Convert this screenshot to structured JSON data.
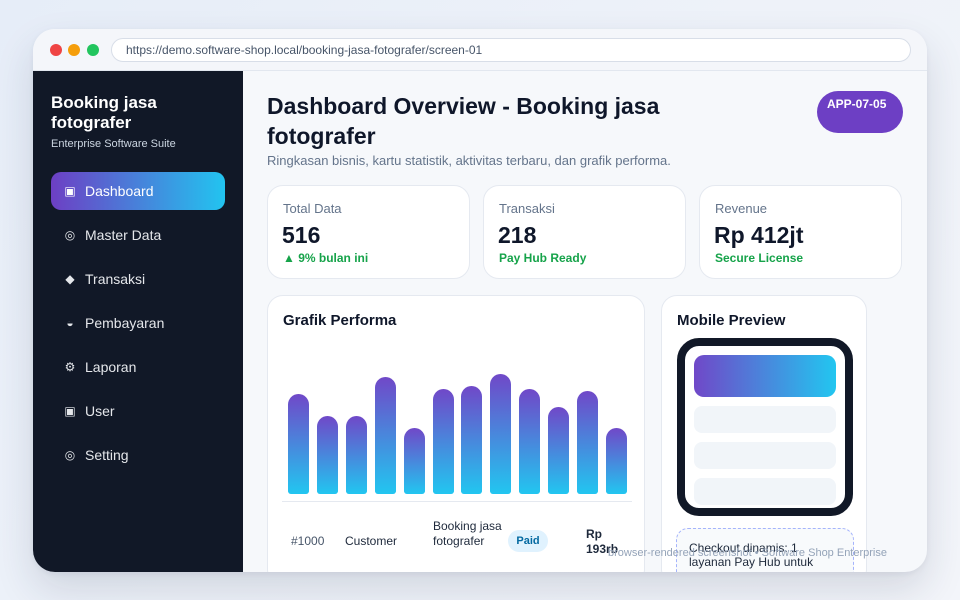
{
  "browser": {
    "url": "https://demo.software-shop.local/booking-jasa-fotografer/screen-01"
  },
  "sidebar": {
    "brand": "Booking jasa fotografer",
    "subtitle": "Enterprise Software Suite",
    "items": [
      {
        "label": "Dashboard",
        "icon": "▣",
        "icon_name": "dashboard-icon",
        "active": true
      },
      {
        "label": "Master Data",
        "icon": "◎",
        "icon_name": "master-data-icon",
        "active": false
      },
      {
        "label": "Transaksi",
        "icon": "◆",
        "icon_name": "transaksi-icon",
        "active": false
      },
      {
        "label": "Pembayaran",
        "icon": "◒",
        "icon_name": "pembayaran-icon",
        "active": false
      },
      {
        "label": "Laporan",
        "icon": "⚙",
        "icon_name": "laporan-icon",
        "active": false
      },
      {
        "label": "User",
        "icon": "▣",
        "icon_name": "user-icon",
        "active": false
      },
      {
        "label": "Setting",
        "icon": "◎",
        "icon_name": "setting-icon",
        "active": false
      }
    ]
  },
  "header": {
    "title": "Dashboard Overview - Booking jasa fotografer",
    "subtitle": "Ringkasan bisnis, kartu statistik, aktivitas terbaru, dan grafik performa.",
    "badge": "APP-07-05"
  },
  "stats": [
    {
      "label": "Total Data",
      "value": "516",
      "note": "▲ 9% bulan ini"
    },
    {
      "label": "Transaksi",
      "value": "218",
      "note": "Pay Hub Ready"
    },
    {
      "label": "Revenue",
      "value": "Rp 412jt",
      "note": "Secure License"
    }
  ],
  "chart": {
    "title": "Grafik Performa"
  },
  "chart_data": {
    "type": "bar",
    "title": "Grafik Performa",
    "xlabel": "",
    "ylabel": "",
    "values": [
      100,
      78,
      78,
      117,
      66,
      105,
      108,
      120,
      105,
      87,
      103,
      66
    ],
    "ylim": [
      0,
      130
    ],
    "grid": false,
    "legend": "none"
  },
  "table": {
    "rows": [
      {
        "id": "#1000",
        "customer": "Customer",
        "service": "Booking jasa fotografer",
        "status": "Paid",
        "amount": "Rp 193rb"
      }
    ]
  },
  "mobile": {
    "title": "Mobile Preview",
    "checkout_text": "Checkout dinamis: 1 layanan Pay Hub untuk"
  },
  "footer": {
    "watermark": "browser-rendered screenshot • Software Shop Enterprise"
  },
  "colors": {
    "accent_start": "#6d3fc4",
    "accent_end": "#22c4f0",
    "sidebar_bg": "#111827",
    "positive": "#16a34a"
  }
}
